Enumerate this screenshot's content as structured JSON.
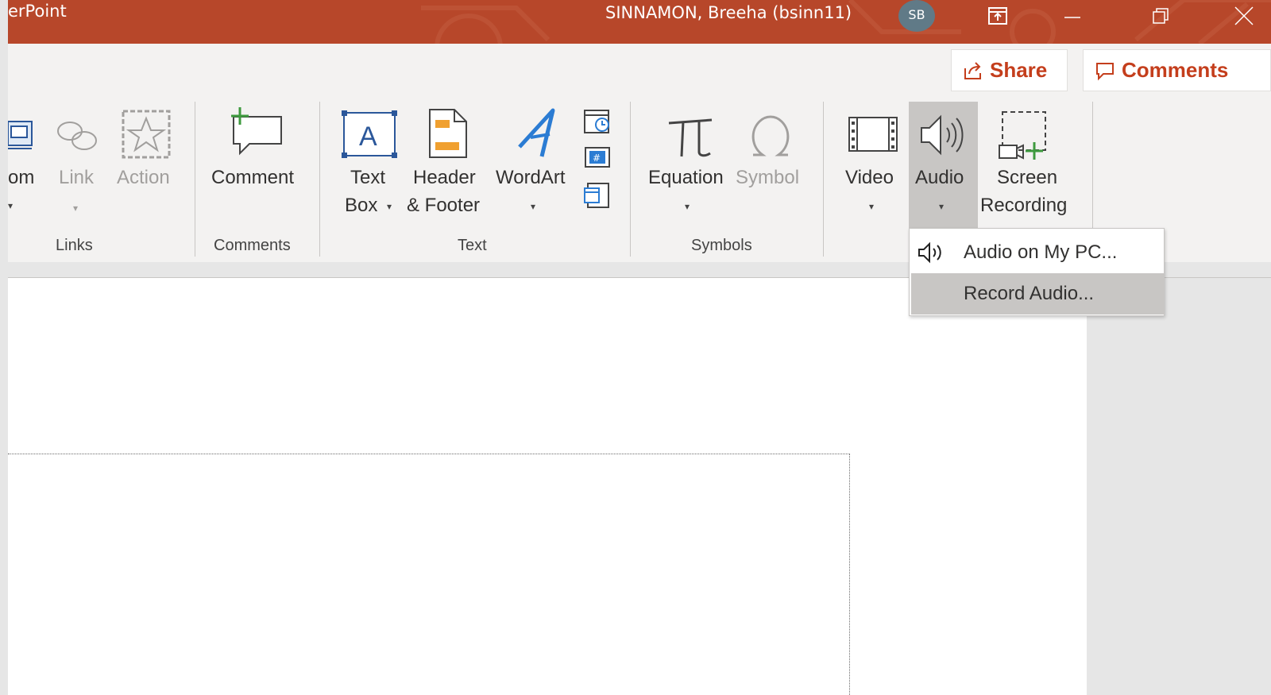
{
  "titlebar": {
    "app_name": "erPoint",
    "user_name": "SINNAMON, Breeha (bsinn11)",
    "avatar_initials": "SB",
    "background": "#b7472a",
    "icons": [
      "ribbon-display-icon",
      "minimize-icon",
      "restore-icon",
      "close-icon"
    ]
  },
  "header_actions": {
    "share_label": "Share",
    "comments_label": "Comments",
    "accent": "#c43e1c"
  },
  "ribbon": {
    "links_group": {
      "zoom_label": "om",
      "link_label": "Link",
      "action_label": "Action",
      "group_label": "Links"
    },
    "comments_group": {
      "comment_label": "Comment",
      "group_label": "Comments"
    },
    "text_group": {
      "textbox_line1": "Text",
      "textbox_line2": "Box",
      "header_line1": "Header",
      "header_line2": "& Footer",
      "wordart_label": "WordArt",
      "group_label": "Text"
    },
    "symbols_group": {
      "equation_label": "Equation",
      "symbol_label": "Symbol",
      "group_label": "Symbols"
    },
    "media_group": {
      "video_label": "Video",
      "audio_label": "Audio",
      "screen_rec_line1": "Screen",
      "screen_rec_line2": "Recording"
    }
  },
  "audio_dropdown": {
    "items": [
      {
        "label": "Audio on My PC...",
        "icon": "speaker-icon",
        "highlighted": false
      },
      {
        "label": "Record Audio...",
        "icon": "",
        "highlighted": true
      }
    ]
  }
}
